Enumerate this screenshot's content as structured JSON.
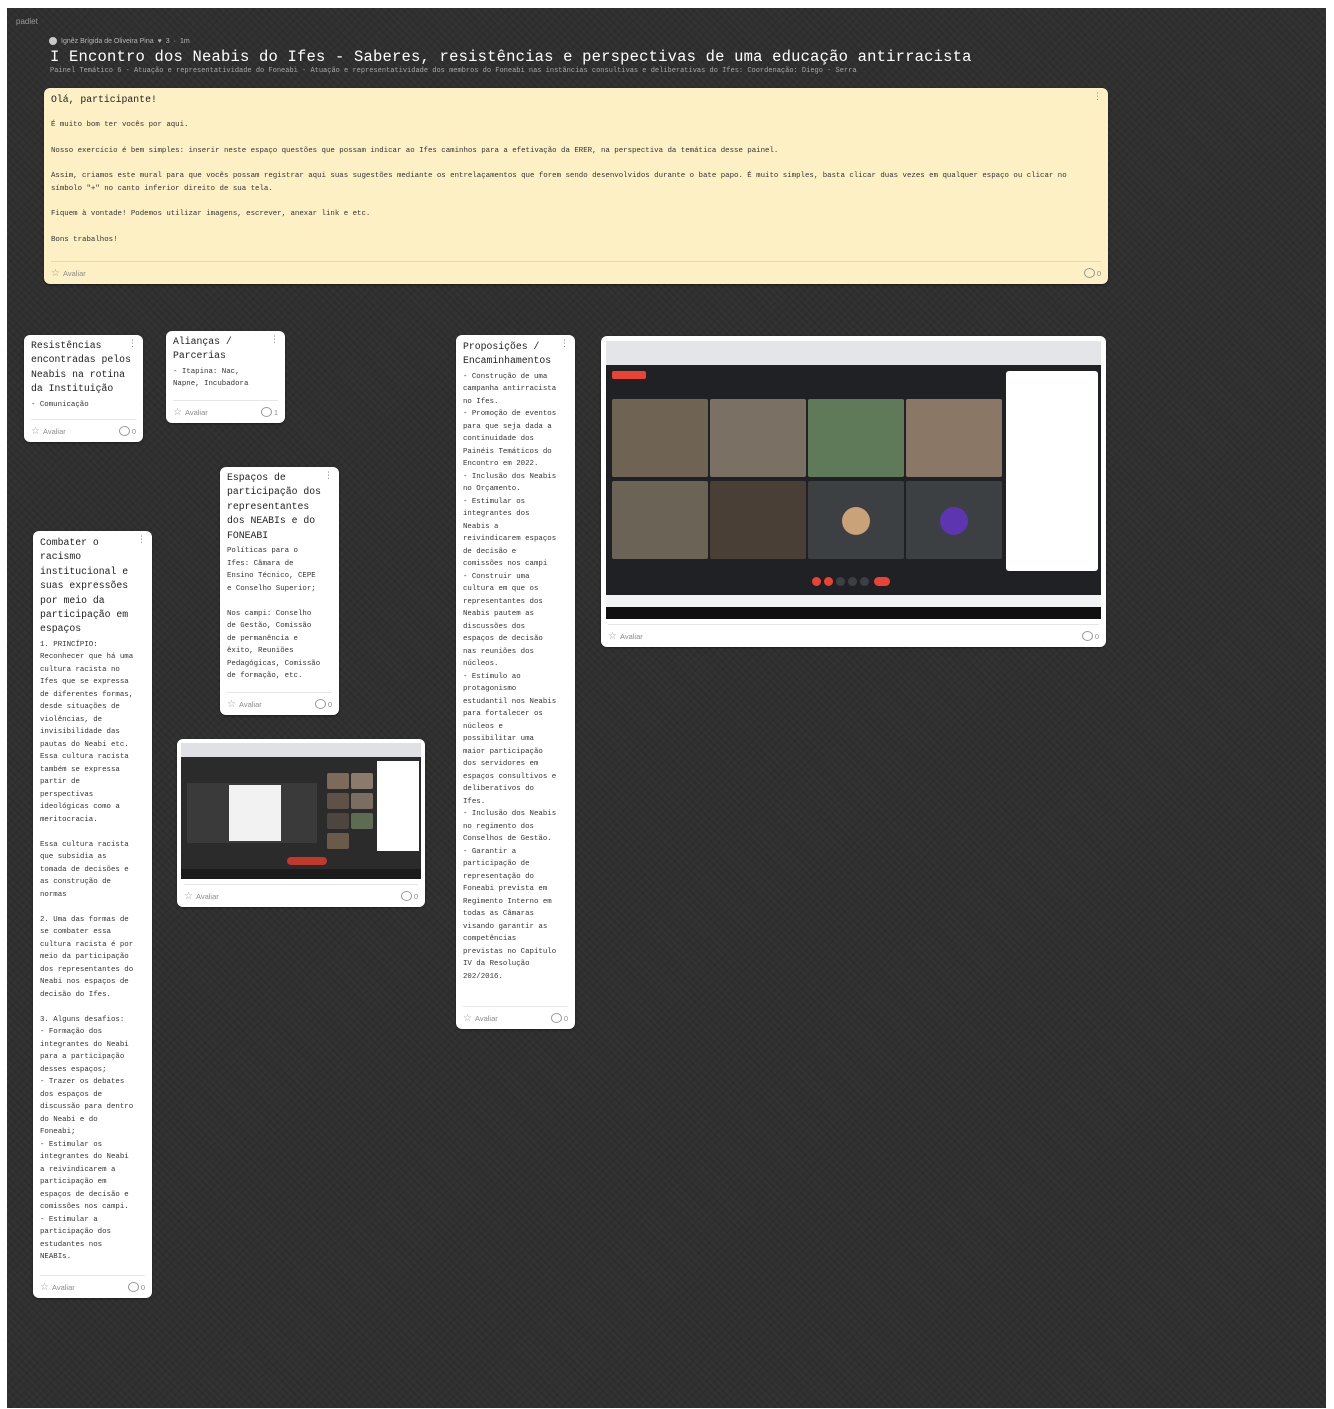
{
  "header": {
    "brand": "padlet",
    "author": "Ignêz Brígida de Oliveira Pina",
    "likes": "3",
    "time": "1m",
    "title": "I Encontro dos Neabis do Ifes - Saberes, resistências e perspectivas de uma educação antirracista",
    "subtitle": "Painel Temático 6 - Atuação e representatividade do Foneabi - Atuação e representatividade dos membros do Foneabi nas instâncias consultivas e deliberativas do Ifes: Coordenação: Diego - Serra"
  },
  "welcome": {
    "heading": "Olá, participante!",
    "p1": "É muito bom ter vocês por aqui.",
    "p2": "Nosso exercício é bem simples: inserir neste espaço questões que possam indicar ao Ifes caminhos para a efetivação da ERER, na perspectiva da temática desse painel.",
    "p3": "Assim, criamos este mural para que vocês possam registrar aqui suas sugestões mediante os entrelaçamentos que forem sendo desenvolvidos durante o bate papo. É muito simples, basta clicar duas vezes em qualquer espaço ou clicar no símbolo \"+\" no canto inferior direito de sua tela.",
    "p4": "Fiquem à vontade! Podemos utilizar imagens, escrever, anexar link e etc.",
    "p5": "Bons trabalhos!",
    "rate": "Avaliar",
    "comments": "0"
  },
  "cards": {
    "resistencias": {
      "title": "Resistências\nencontradas pelos\nNeabis na rotina\nda Instituição",
      "body": "- Comunicação",
      "rate": "Avaliar",
      "comments": "0"
    },
    "aliancas": {
      "title": "Alianças /\nParcerias",
      "body": "- Itapina: Nac,\nNapne, Incubadora",
      "rate": "Avaliar",
      "comments": "1"
    },
    "espacos": {
      "title": "Espaços de\nparticipação dos\nrepresentantes\ndos NEABIs e do\nFONEABI",
      "body": "Políticas para o\nIfes: Câmara de\nEnsino Técnico, CEPE\ne Conselho Superior;\n\nNos campi: Conselho\nde Gestão, Comissão\nde permanência e\nêxito, Reuniões\nPedagógicas, Comissão\nde formação, etc.",
      "rate": "Avaliar",
      "comments": "0"
    },
    "combater": {
      "title": "Combater o\nracismo\ninstitucional e\nsuas expressões\npor meio da\nparticipação em\nespaços",
      "body": "1. PRINCÍPIO:\nReconhecer que há uma\ncultura racista no\nIfes que se expressa\nde diferentes formas,\ndesde situações de\nviolências, de\ninvisibilidade das\npautas do Neabi etc.\nEssa cultura racista\ntambém se expressa\npartir de\nperspectivas\nideológicas como a\nmeritocracia.\n\nEssa cultura racista\nque subsidia as\ntomada de decisões e\nas construção de\nnormas\n\n2. Uma das formas de\nse combater essa\ncultura racista é por\nmeio da participação\ndos representantes do\nNeabi nos espaços de\ndecisão do Ifes.\n\n3. Alguns desafios:\n- Formação dos\nintegrantes do Neabi\npara a participação\ndesses espaços;\n- Trazer os debates\ndos espaços de\ndiscussão para dentro\ndo Neabi e do\nFoneabi;\n- Estimular os\nintegrantes do Neabi\na reivindicarem a\nparticipação em\nespaços de decisão e\ncomissões nos campi.\n- Estimular a\nparticipação dos\nestudantes nos\nNEABIs.",
      "rate": "Avaliar",
      "comments": "0"
    },
    "proposicoes": {
      "title": "Proposições /\nEncaminhamentos",
      "body": "- Construção de uma\ncampanha antirracista\nno Ifes.\n- Promoção de eventos\npara que seja dada a\ncontinuidade dos\nPainéis Temáticos do\nEncontro em 2022.\n- Inclusão dos Neabis\nno Orçamento.\n- Estimular os\nintegrantes dos\nNeabis a\nreivindicarem espaços\nde decisão e\ncomissões nos campi\n- Construir uma\ncultura em que os\nrepresentantes dos\nNeabis pautem as\ndiscussões dos\nespaços de decisão\nnas reuniões dos\nnúcleos.\n- Estímulo ao\nprotagonismo\nestudantil nos Neabis\npara fortalecer os\nnúcleos e\npossibilitar uma\nmaior participação\ndos servidores em\nespaços consultivos e\ndeliberativos do\nIfes.\n- Inclusão dos Neabis\nno regimento dos\nConselhos de Gestão.\n- Garantir a\nparticipação de\nrepresentação do\nFoneabi prevista em\nRegimento Interno em\ntodas as Câmaras\nvisando garantir as\ncompetências\nprevistas no Capítulo\nIV da Resolução\n202/2016.",
      "rate": "Avaliar",
      "comments": "0"
    },
    "screenshot_small": {
      "rate": "Avaliar",
      "comments": "0"
    },
    "screenshot_large": {
      "rate": "Avaliar",
      "comments": "0"
    }
  },
  "colors": {
    "board": "#2f2f2f",
    "welcome_bg": "#fdf0c4",
    "card_bg": "#ffffff",
    "meet_bg": "#202124",
    "meet_end_call": "#ea4335"
  },
  "icons": [
    "heart-icon",
    "star-icon",
    "comment-icon",
    "more-icon"
  ]
}
